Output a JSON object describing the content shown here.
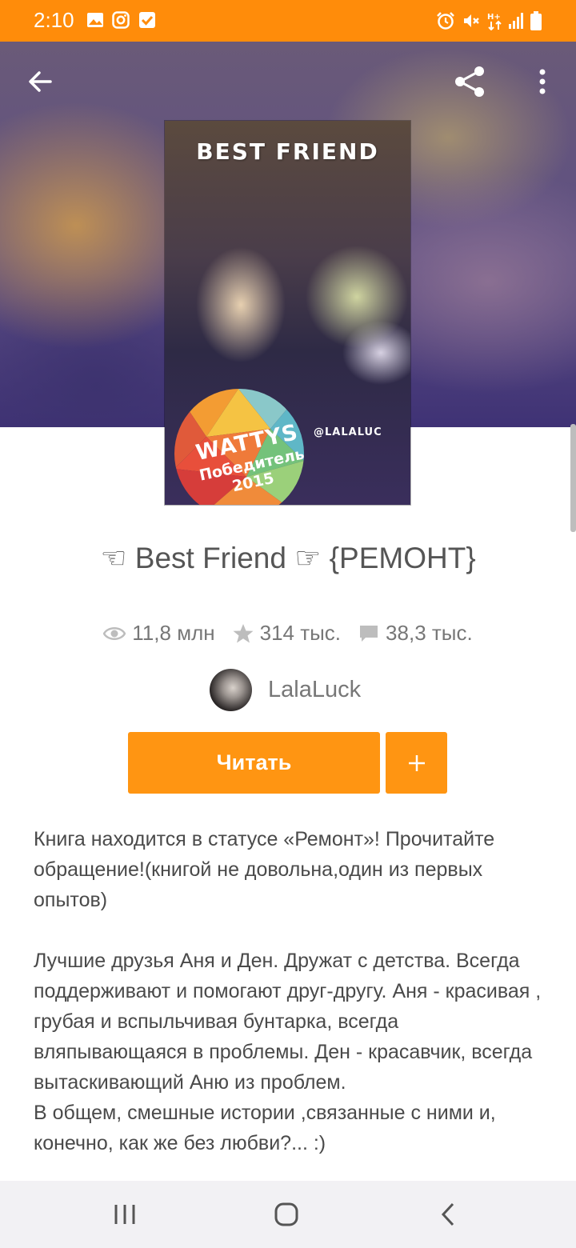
{
  "status_bar": {
    "time": "2:10",
    "icons": [
      "image-icon",
      "instagram-icon",
      "check-box-icon",
      "alarm-icon",
      "mute-icon",
      "data-arrows-icon",
      "signal-icon",
      "battery-icon"
    ]
  },
  "toolbar": {
    "back_icon": "arrow-left-icon",
    "share_icon": "share-icon",
    "menu_icon": "more-vertical-icon"
  },
  "cover": {
    "title": "BEST FRIEND",
    "handle": "@LALALUC",
    "badge_brand": "WATTYS",
    "badge_text": "Победитель",
    "badge_year": "2015"
  },
  "story": {
    "title": "☜ Best Friend ☞ {РЕМОНТ}"
  },
  "stats": {
    "reads": "11,8 млн",
    "votes": "314 тыс.",
    "comments": "38,3 тыс."
  },
  "author": {
    "name": "LalaLuck"
  },
  "actions": {
    "read_label": "Читать",
    "add_label": "+"
  },
  "description": {
    "para1": "Книга находится в статусе «Ремонт»! Прочитайте обращение!(книгой не довольна,один из первых опытов)",
    "para2": "Лучшие друзья Аня и Ден. Дружат с детства. Всегда поддерживают и помогают друг-другу. Аня - красивая , грубая и вспыльчивая бунтарка, всегда вляпывающаяся в проблемы. Ден - красавчик, всегда вытаскивающий Аню из проблем.",
    "para3": "В общем, смешные истории ,связанные с ними и, конечно, как же без любви?... :)"
  },
  "colors": {
    "accent": "#ff9512",
    "status_bar": "#ff8c0a"
  }
}
